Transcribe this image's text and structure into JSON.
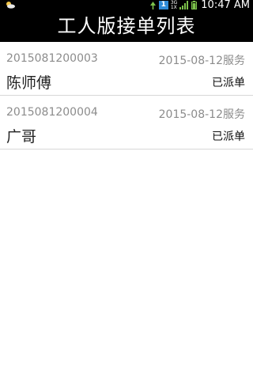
{
  "status_bar": {
    "left_icon": "weather-cloud-icon",
    "sim_label": "1",
    "network_labels": [
      "3G",
      "1X"
    ],
    "time": "10:47 AM"
  },
  "header": {
    "title": "工人版接单列表"
  },
  "orders": [
    {
      "id": "2015081200003",
      "date_service": "2015-08-12服务",
      "name": "陈师傅",
      "status": "已派单"
    },
    {
      "id": "2015081200004",
      "date_service": "2015-08-12服务",
      "name": "广哥",
      "status": "已派单"
    }
  ],
  "colors": {
    "bar_background": "#000000",
    "secondary_text": "#8c8c8c",
    "divider": "#d8d8d8",
    "sim_badge": "#2f8bd7"
  }
}
